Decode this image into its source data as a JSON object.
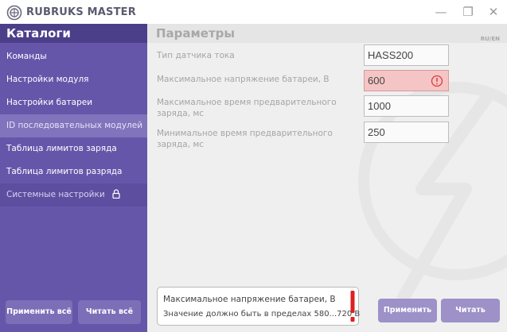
{
  "app": {
    "title": "RUBRUKS MASTER",
    "window_controls": {
      "minimize": "—",
      "maximize": "❐",
      "close": "✕"
    }
  },
  "sidebar": {
    "header": "Каталоги",
    "items": [
      {
        "label": "Команды"
      },
      {
        "label": "Настройки модуля"
      },
      {
        "label": "Настройки батареи"
      },
      {
        "label": "ID последовательных модулей",
        "active": true
      },
      {
        "label": "Таблица лимитов заряда"
      },
      {
        "label": "Таблица лимитов разряда"
      },
      {
        "label": "Системные настройки",
        "locked": true,
        "icon": "lock-icon"
      }
    ],
    "apply_all_label": "Применить всё",
    "read_all_label": "Читать всё"
  },
  "main": {
    "header": "Параметры",
    "lang_switch": "RU/EN",
    "params": [
      {
        "label": "Тип датчика тока",
        "value": "HASS200"
      },
      {
        "label": "Максимальное напряжение батареи, В",
        "value": "600",
        "error": true,
        "icon": "error-circle-icon"
      },
      {
        "label": "Максимальное время предварительного заряда, мс",
        "value": "1000"
      },
      {
        "label": "Минимальное время предварительного заряда, мс",
        "value": "250"
      }
    ],
    "message": {
      "title": "Максимальное напряжение батареи, В",
      "text": "Значение должно быть в пределах 580...720 В",
      "icon": "exclamation-icon"
    },
    "apply_label": "Применить",
    "read_label": "Читать"
  },
  "colors": {
    "sidebar_bg": "#6656aa",
    "sidebar_header_bg": "#4b3f8a",
    "active_item_bg": "#8273bd",
    "error_field_bg": "#f5c5c5",
    "error_red": "#e02020",
    "main_bg": "#efefef"
  }
}
